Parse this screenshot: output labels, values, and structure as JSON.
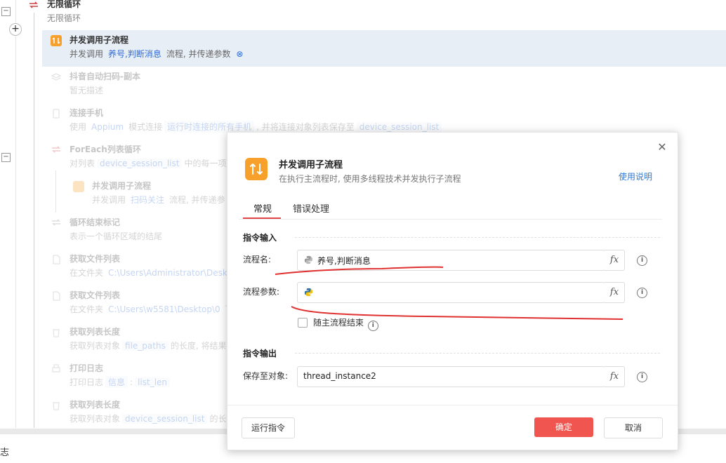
{
  "flow": {
    "loop_title": "无限循环",
    "loop_desc": "无限循环",
    "items": [
      {
        "title": "并发调用子流程",
        "d1": "并发调用",
        "chip": "养号,判断消息",
        "d2": "流程, 并传递参数"
      },
      {
        "title": "抖音自动扫码-副本",
        "d1": "暂无描述"
      },
      {
        "title": "连接手机",
        "d1": "使用",
        "chip": "Appium",
        "d2": "模式连接",
        "chip2": "运行时连接的所有手机",
        "d3": ", 并将连接对象列表保存至",
        "chip3": "device_session_list"
      },
      {
        "title": "ForEach列表循环",
        "d1": "对列表",
        "chip": "device_session_list",
        "d2": "中的每一项进"
      },
      {
        "title": "并发调用子流程",
        "d1": "并发调用",
        "chip": "扫码关注",
        "d2": "流程, 并传递参"
      },
      {
        "title": "循环结束标记",
        "d1": "表示一个循环区域的结尾"
      },
      {
        "title": "获取文件列表",
        "d1": "在文件夹",
        "chip": "C:\\Users\\Administrator\\Deskt"
      },
      {
        "title": "获取文件列表",
        "d1": "在文件夹",
        "chip": "C:\\Users\\w5581\\Desktop\\0",
        "d2": "下"
      },
      {
        "title": "获取列表长度",
        "d1": "获取列表对象",
        "chip": "file_paths",
        "d2": "的长度, 将结果"
      },
      {
        "title": "打印日志",
        "d1": "打印日志",
        "chip": "信息",
        "d2": ":",
        "chip2": "list_len"
      },
      {
        "title": "获取列表长度",
        "d1": "获取列表对象",
        "chip": "device_session_list",
        "d2": "的长度"
      }
    ],
    "partial_text": "志"
  },
  "modal": {
    "title": "并发调用子流程",
    "subtitle": "在执行主流程时, 使用多线程技术并发执行子流程",
    "help_link": "使用说明",
    "tabs": [
      "常规",
      "错误处理"
    ],
    "active_tab": "常规",
    "input_section": "指令输入",
    "output_section": "指令输出",
    "fields": {
      "flow_name": {
        "label": "流程名:",
        "value": "养号,判断消息"
      },
      "flow_params": {
        "label": "流程参数:",
        "value": ""
      },
      "save_to": {
        "label": "保存至对象:",
        "value": "thread_instance2"
      }
    },
    "checkbox_label": "随主流程结束",
    "fx_label": "fx",
    "info_glyph": "i",
    "buttons": {
      "run": "运行指令",
      "ok": "确定",
      "cancel": "取消"
    },
    "colors": {
      "accent": "#e04646",
      "primary_button": "#f0554f",
      "link": "#2e7bd6",
      "icon_bg": "#f7a02b"
    }
  }
}
